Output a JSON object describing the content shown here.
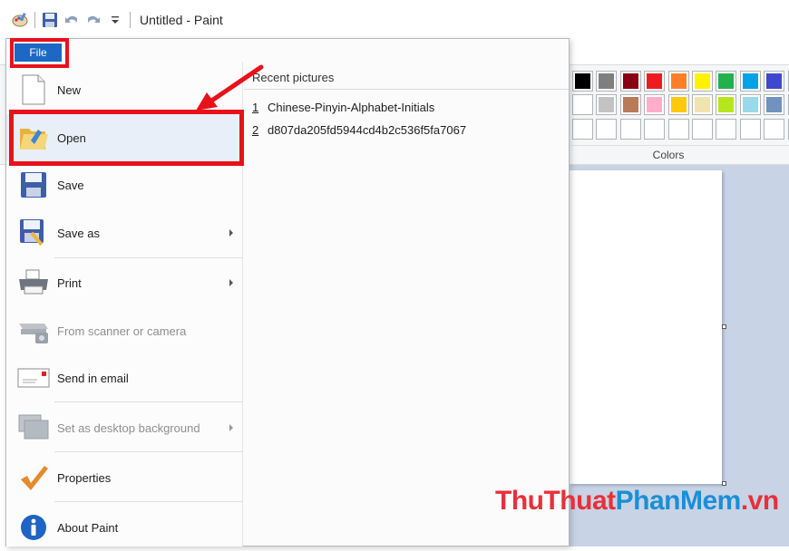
{
  "window": {
    "title": "Untitled - Paint"
  },
  "quick_access": [
    {
      "name": "paint-app-icon"
    },
    {
      "name": "save-icon"
    },
    {
      "name": "undo-icon"
    },
    {
      "name": "redo-icon"
    },
    {
      "name": "customize-dropdown-icon"
    }
  ],
  "ribbon": {
    "file_label": "File",
    "colors_label": "Colors",
    "palette_row1": [
      "#000000",
      "#7f7f7f",
      "#880015",
      "#ed1c24",
      "#ff7f27",
      "#fff200",
      "#22b14c",
      "#00a2e8",
      "#3f48cc",
      "#a349a4"
    ],
    "palette_row2": [
      "#ffffff",
      "#c3c3c3",
      "#b97a57",
      "#ffaec9",
      "#ffc90e",
      "#efe4b0",
      "#b5e61d",
      "#99d9ea",
      "#7092be",
      "#c8bfe7"
    ],
    "palette_row3": [
      "#ffffff",
      "#ffffff",
      "#ffffff",
      "#ffffff",
      "#ffffff",
      "#ffffff",
      "#ffffff",
      "#ffffff",
      "#ffffff",
      "#ffffff"
    ]
  },
  "file_menu": {
    "items": [
      {
        "label": "New",
        "icon": "new-document-icon",
        "enabled": true,
        "submenu": false
      },
      {
        "label": "Open",
        "icon": "open-folder-icon",
        "enabled": true,
        "submenu": false
      },
      {
        "label": "Save",
        "icon": "save-icon",
        "enabled": true,
        "submenu": false
      },
      {
        "label": "Save as",
        "icon": "save-as-icon",
        "enabled": true,
        "submenu": true
      },
      {
        "label": "Print",
        "icon": "printer-icon",
        "enabled": true,
        "submenu": true
      },
      {
        "label": "From scanner or camera",
        "icon": "scanner-icon",
        "enabled": false,
        "submenu": false
      },
      {
        "label": "Send in email",
        "icon": "email-icon",
        "enabled": true,
        "submenu": false
      },
      {
        "label": "Set as desktop background",
        "icon": "desktop-background-icon",
        "enabled": false,
        "submenu": true
      },
      {
        "label": "Properties",
        "icon": "checkmark-icon",
        "enabled": true,
        "submenu": false
      },
      {
        "label": "About Paint",
        "icon": "info-icon",
        "enabled": true,
        "submenu": false
      }
    ],
    "recent": {
      "title": "Recent pictures",
      "items": [
        {
          "num": "1",
          "name": "Chinese-Pinyin-Alphabet-Initials"
        },
        {
          "num": "2",
          "name": "d807da205fd5944cd4b2c536f5fa7067"
        }
      ]
    }
  },
  "annotation": {
    "highlight_color": "#e8111a"
  },
  "watermark": {
    "part1": "ThuThuat",
    "part2": "PhanMem",
    "part3": ".vn"
  }
}
